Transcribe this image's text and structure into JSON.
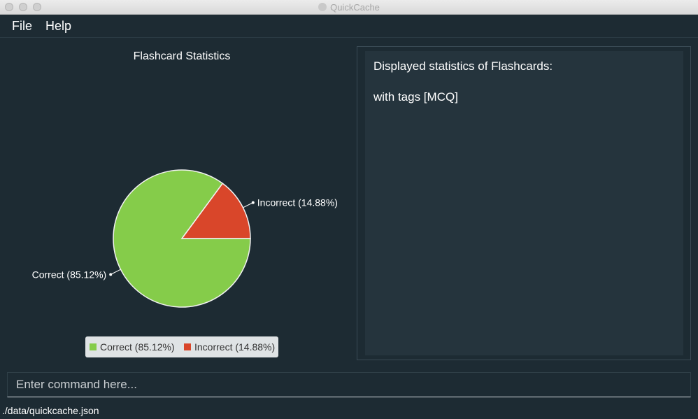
{
  "window": {
    "title": "QuickCache"
  },
  "menu": {
    "file": "File",
    "help": "Help"
  },
  "chart_data": {
    "type": "pie",
    "title": "Flashcard Statistics",
    "slices": [
      {
        "label": "Correct (85.12%)",
        "value": 85.12,
        "color": "#85cc4a"
      },
      {
        "label": "Incorrect (14.88%)",
        "value": 14.88,
        "color": "#d9462a"
      }
    ],
    "legend": "bottom"
  },
  "result": {
    "line1": "Displayed statistics of Flashcards:",
    "line2": "with tags [MCQ]"
  },
  "command": {
    "placeholder": "Enter command here..."
  },
  "status": {
    "path": "./data/quickcache.json"
  }
}
